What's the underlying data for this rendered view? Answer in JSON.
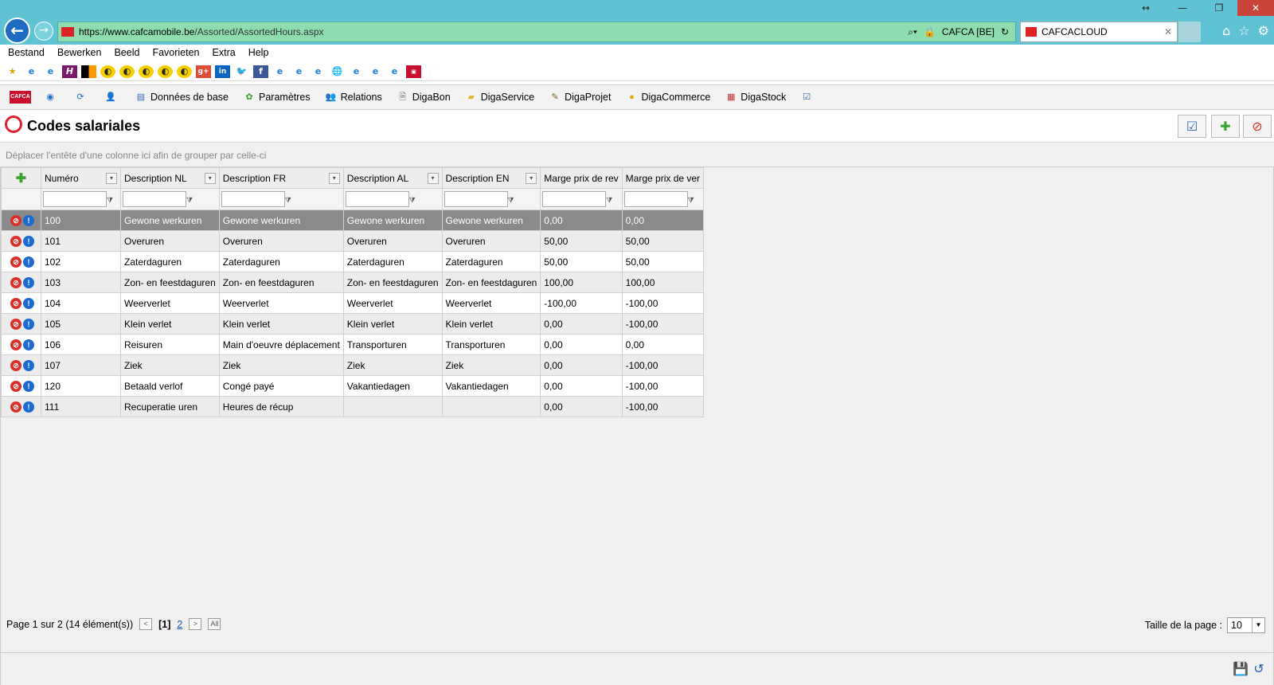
{
  "browser": {
    "url_prefix": "https://",
    "url_domain": "www.cafcamobile.be",
    "url_path": "/Assorted/AssortedHours.aspx",
    "site_identity": "CAFCA [BE]",
    "tab_title": "CAFCACLOUD"
  },
  "menu": [
    "Bestand",
    "Bewerken",
    "Beeld",
    "Favorieten",
    "Extra",
    "Help"
  ],
  "app_toolbar": {
    "logo_text": "CAFCA",
    "items": [
      "Données de base",
      "Paramètres",
      "Relations",
      "DigaBon",
      "DigaService",
      "DigaProjet",
      "DigaCommerce",
      "DigaStock"
    ]
  },
  "page": {
    "title": "Codes salariales",
    "group_hint": "Déplacer l'entête d'une colonne ici afin de grouper par celle-ci"
  },
  "grid": {
    "columns": [
      "Numéro",
      "Description NL",
      "Description FR",
      "Description AL",
      "Description EN",
      "Marge prix de rev",
      "Marge prix de ver"
    ],
    "rows": [
      [
        "100",
        "Gewone werkuren",
        "Gewone werkuren",
        "Gewone werkuren",
        "Gewone werkuren",
        "0,00",
        "0,00"
      ],
      [
        "101",
        "Overuren",
        "Overuren",
        "Overuren",
        "Overuren",
        "50,00",
        "50,00"
      ],
      [
        "102",
        "Zaterdaguren",
        "Zaterdaguren",
        "Zaterdaguren",
        "Zaterdaguren",
        "50,00",
        "50,00"
      ],
      [
        "103",
        "Zon- en feestdaguren",
        "Zon- en feestdaguren",
        "Zon- en feestdaguren",
        "Zon- en feestdaguren",
        "100,00",
        "100,00"
      ],
      [
        "104",
        "Weerverlet",
        "Weerverlet",
        "Weerverlet",
        "Weerverlet",
        "-100,00",
        "-100,00"
      ],
      [
        "105",
        "Klein verlet",
        "Klein verlet",
        "Klein verlet",
        "Klein verlet",
        "0,00",
        "-100,00"
      ],
      [
        "106",
        "Reisuren",
        "Main d'oeuvre déplacement",
        "Transporturen",
        "Transporturen",
        "0,00",
        "0,00"
      ],
      [
        "107",
        "Ziek",
        "Ziek",
        "Ziek",
        "Ziek",
        "0,00",
        "-100,00"
      ],
      [
        "120",
        "Betaald verlof",
        "Congé payé",
        "Vakantiedagen",
        "Vakantiedagen",
        "0,00",
        "-100,00"
      ],
      [
        "111",
        "Recuperatie uren",
        "Heures de récup",
        "",
        "",
        "0,00",
        "-100,00"
      ]
    ],
    "selected_row": 0
  },
  "pager": {
    "summary": "Page 1 sur 2 (14 élément(s))",
    "prev": "<",
    "current": "[1]",
    "page2": "2",
    "next": ">",
    "all": "All",
    "page_size_label": "Taille de la page :",
    "page_size": "10"
  }
}
